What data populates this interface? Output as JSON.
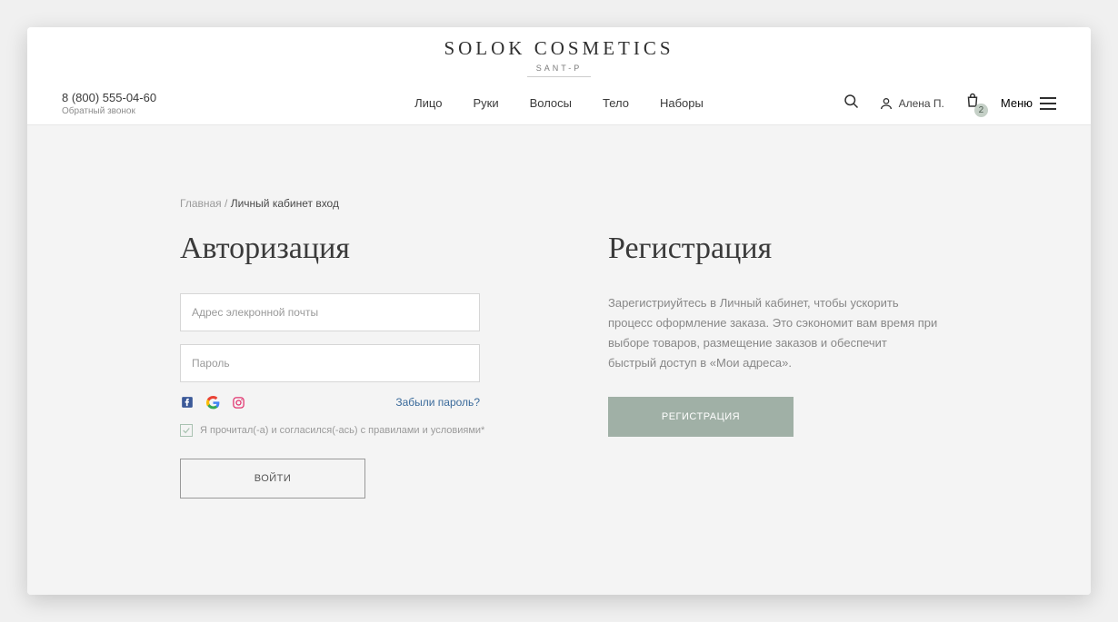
{
  "brand": {
    "name": "SOLOK COSMETICS",
    "sub": "SANT-P"
  },
  "phone": {
    "number": "8 (800) 555-04-60",
    "callback": "Обратный звонок"
  },
  "nav": [
    "Лицо",
    "Руки",
    "Волосы",
    "Тело",
    "Наборы"
  ],
  "account": {
    "name": "Алена П."
  },
  "cart": {
    "count": "2"
  },
  "menu": {
    "label": "Меню"
  },
  "breadcrumb": {
    "home": "Главная",
    "sep": " / ",
    "current": "Личный кабинет вход"
  },
  "auth": {
    "title": "Авторизация",
    "email_placeholder": "Адрес элекронной почты",
    "password_placeholder": "Пароль",
    "forgot": "Забыли пароль?",
    "agree": "Я прочитал(-а) и согласился(-ась) с правилами и условиями*",
    "login_btn": "ВОЙТИ"
  },
  "register": {
    "title": "Регистрация",
    "text": "Зарегистриуйтесь в Личный кабинет, чтобы ускорить процесс оформление заказа. Это сэкономит вам время при выборе товаров, размещение заказов и обеспечит быстрый доступ в «Мои адреса».",
    "btn": "РЕГИСТРАЦИЯ"
  },
  "colors": {
    "accent": "#a0b0a6",
    "link": "#3b6b9b"
  }
}
